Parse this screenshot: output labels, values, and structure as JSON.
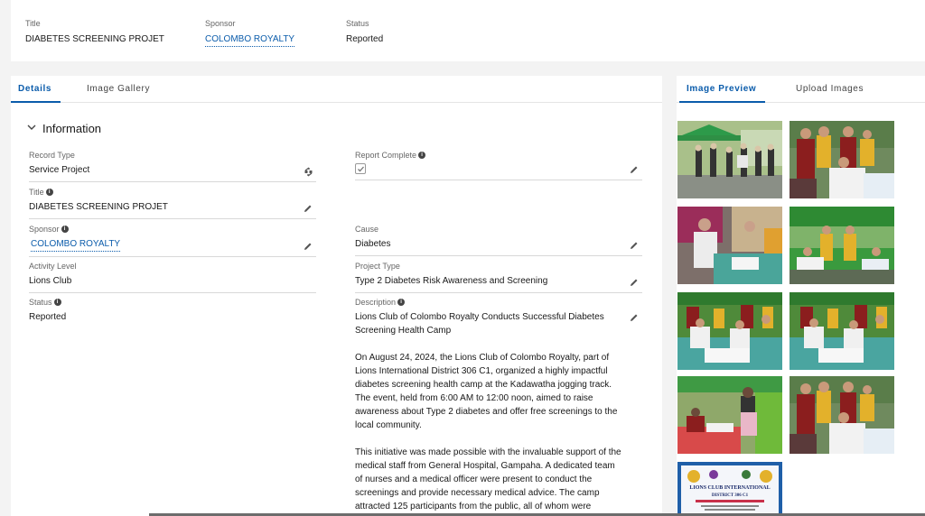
{
  "highlights": {
    "title_label": "Title",
    "title_value": "DIABETES SCREENING PROJET",
    "sponsor_label": "Sponsor",
    "sponsor_value": "COLOMBO ROYALTY",
    "status_label": "Status",
    "status_value": "Reported"
  },
  "left_tabs": [
    "Details",
    "Image Gallery"
  ],
  "right_tabs": [
    "Image Preview",
    "Upload Images"
  ],
  "section": {
    "title": "Information"
  },
  "fields": {
    "record_type": {
      "label": "Record Type",
      "value": "Service Project"
    },
    "title": {
      "label": "Title",
      "value": "DIABETES SCREENING PROJET"
    },
    "sponsor": {
      "label": "Sponsor",
      "value": "COLOMBO ROYALTY"
    },
    "activity_level": {
      "label": "Activity Level",
      "value": "Lions Club"
    },
    "status": {
      "label": "Status",
      "value": "Reported"
    },
    "report_complete": {
      "label": "Report Complete",
      "checked": true
    },
    "cause": {
      "label": "Cause",
      "value": "Diabetes"
    },
    "project_type": {
      "label": "Project Type",
      "value": "Type 2 Diabetes Risk Awareness and Screening"
    },
    "description": {
      "label": "Description",
      "paragraphs": [
        "Lions Club of Colombo Royalty Conducts Successful Diabetes Screening Health Camp",
        "On August 24, 2024, the Lions Club of Colombo Royalty, part of Lions International District 306 C1, organized a highly impactful diabetes screening health camp at the Kadawatha jogging track. The event, held from 6:00 AM to 12:00 noon, aimed to raise awareness about Type 2 diabetes and offer free screenings to the local community.",
        "This initiative was made possible with the invaluable support of the medical staff from General Hospital, Gampaha. A dedicated team of nurses and a medical officer were present to conduct the screenings and provide necessary medical advice. The camp attracted 125 participants from the public, all of whom were"
      ]
    }
  },
  "gallery": {
    "banner_text": [
      "LIONS CLUB INTERNATIONAL",
      "DISTRICT 306 C1"
    ],
    "colors": {
      "accent": "#0b5cab",
      "tent_green": "#3a9a3e",
      "shirt_yellow": "#e3b12b"
    }
  }
}
